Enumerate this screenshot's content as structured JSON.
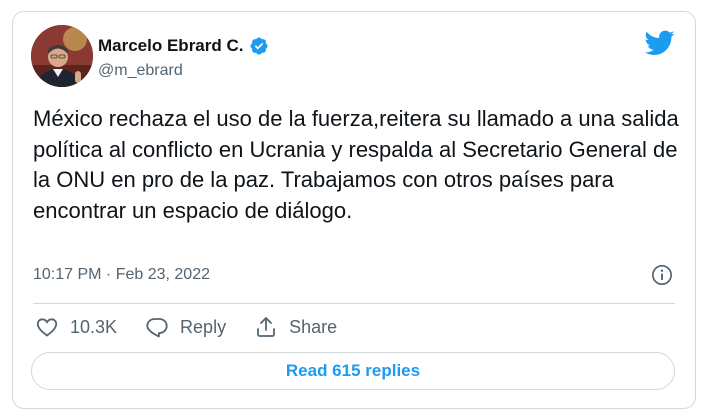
{
  "tweet": {
    "author_name": "Marcelo Ebrard C.",
    "author_handle": "@m_ebrard",
    "text": "México rechaza el uso de la fuerza,reitera su llamado a una salida política al conflicto en Ucrania y respalda al Secretario General de la ONU en pro de la paz. Trabajamos con otros países para encontrar un espacio de diálogo.",
    "timestamp": "10:17 PM · Feb 23, 2022"
  },
  "actions": {
    "like_count": "10.3K",
    "reply_label": "Reply",
    "share_label": "Share"
  },
  "read_replies_label": "Read 615 replies",
  "icons": {
    "brand": "twitter-bird-icon",
    "verified": "verified-badge-icon",
    "info": "info-icon",
    "like": "heart-icon",
    "reply": "reply-icon",
    "share": "share-icon"
  },
  "colors": {
    "accent": "#1d9bf0",
    "text": "#0f1419",
    "secondary_text": "#536471",
    "border": "#cfd9de"
  }
}
